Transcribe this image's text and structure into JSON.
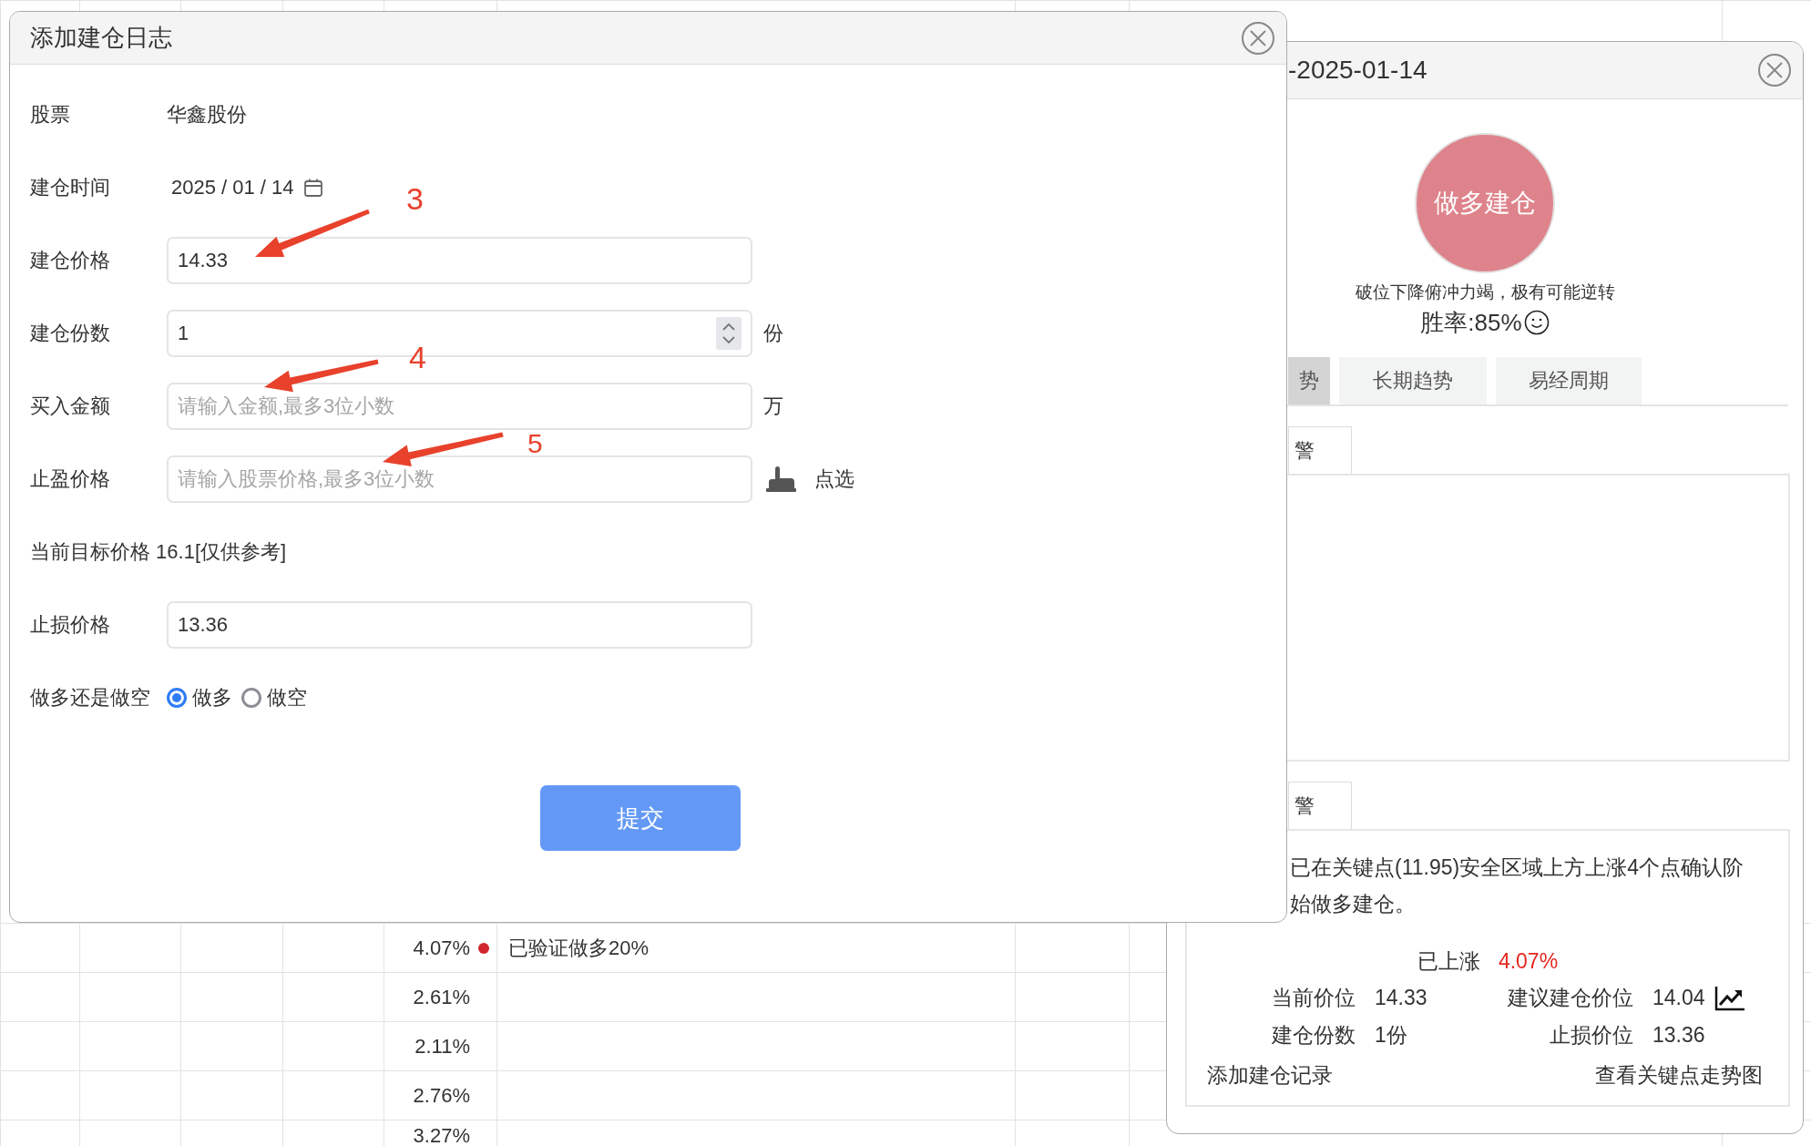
{
  "background_table": {
    "rows": [
      {
        "change": "4.07%",
        "color": "#d0262d",
        "note": "已验证做多20%"
      },
      {
        "change": "2.61%"
      },
      {
        "change": "2.11%"
      },
      {
        "change": "2.76%"
      },
      {
        "change": "3.27%"
      }
    ]
  },
  "detail_panel": {
    "title": "-2025-01-14",
    "signal": "做多建仓",
    "reason": "破位下降俯冲力竭，极有可能逆转",
    "win_rate": "胜率:85%",
    "tabs": [
      {
        "label": "势",
        "selected": true
      },
      {
        "label": "长期趋势",
        "selected": false
      },
      {
        "label": "易经周期",
        "selected": false
      }
    ],
    "alert_boxes": [
      {
        "tab": "警"
      },
      {
        "tab": "警",
        "text_lines": [
          "已在关键点(11.95)安全区域上方上涨4个点确认阶",
          "始做多建仓。"
        ],
        "rise_label": "已上涨",
        "rise_value": "4.07%",
        "stats": [
          {
            "label": "当前价位",
            "value": "14.33"
          },
          {
            "label": "建议建仓价位",
            "value": "14.04"
          },
          {
            "label": "建仓份数",
            "value": "1份"
          },
          {
            "label": "止损价位",
            "value": "13.36"
          }
        ],
        "links": [
          "添加建仓记录",
          "查看关键点走势图"
        ]
      }
    ]
  },
  "dialog": {
    "title": "添加建仓日志",
    "fields": [
      {
        "kind": "static",
        "label": "股票",
        "value": "华鑫股份"
      },
      {
        "kind": "date",
        "label": "建仓时间",
        "value": "2025 / 01 / 14"
      },
      {
        "kind": "input",
        "label": "建仓价格",
        "value": "14.33"
      },
      {
        "kind": "number",
        "label": "建仓份数",
        "value": "1",
        "suffix": "份"
      },
      {
        "kind": "input",
        "label": "买入金额",
        "placeholder": "请输入金额,最多3位小数",
        "suffix": "万"
      },
      {
        "kind": "input",
        "label": "止盈价格",
        "placeholder": "请输入股票价格,最多3位小数",
        "action": "点选"
      },
      {
        "kind": "note",
        "label": "当前目标价格 16.1[仅供参考]"
      },
      {
        "kind": "input",
        "label": "止损价格",
        "value": "13.36"
      },
      {
        "kind": "radio",
        "label": "做多还是做空",
        "options": [
          {
            "label": "做多",
            "selected": true
          },
          {
            "label": "做空",
            "selected": false
          }
        ]
      }
    ],
    "submit": "提交"
  },
  "annotations": [
    {
      "label": "3"
    },
    {
      "label": "4"
    },
    {
      "label": "5"
    }
  ]
}
